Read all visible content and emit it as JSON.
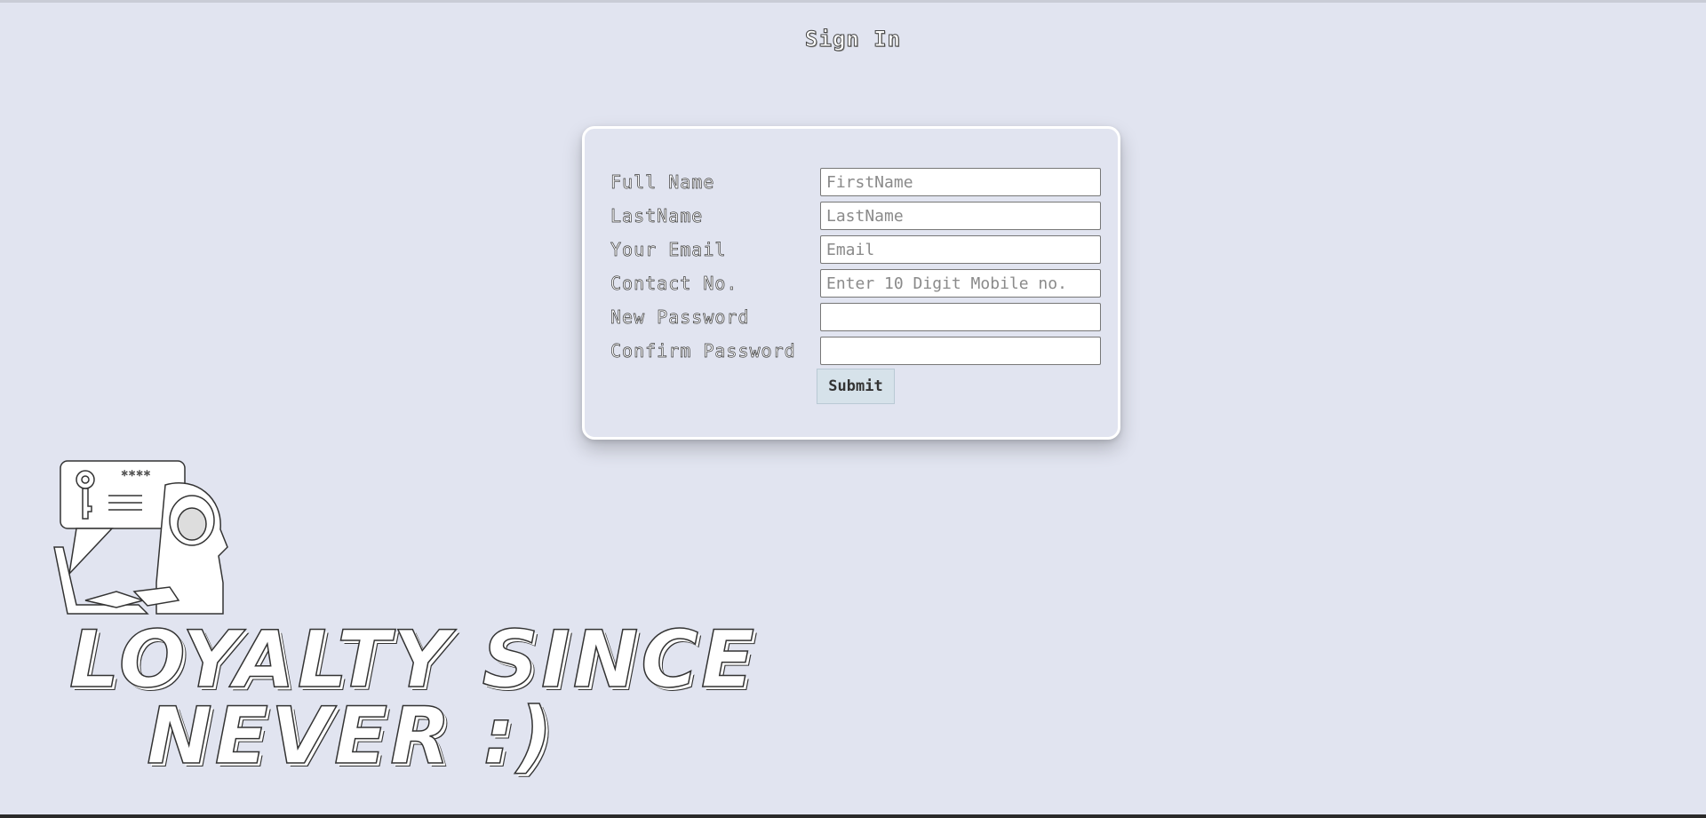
{
  "page": {
    "title": "Sign In"
  },
  "form": {
    "fields": [
      {
        "label": "Full Name",
        "placeholder": "FirstName",
        "value": ""
      },
      {
        "label": "LastName",
        "placeholder": "LastName",
        "value": ""
      },
      {
        "label": "Your Email",
        "placeholder": "Email",
        "value": ""
      },
      {
        "label": "Contact No.",
        "placeholder": "Enter 10 Digit Mobile no.",
        "value": ""
      },
      {
        "label": "New Password",
        "placeholder": "",
        "value": ""
      },
      {
        "label": "Confirm Password",
        "placeholder": "",
        "value": ""
      }
    ],
    "submit_label": "Submit"
  },
  "banner": {
    "line1": "LOYALTY SINCE",
    "line2": "NEVER :)",
    "illustration_stars": "****"
  },
  "colors": {
    "background": "#e1e4f0",
    "submit_bg": "#d6e2ea"
  }
}
